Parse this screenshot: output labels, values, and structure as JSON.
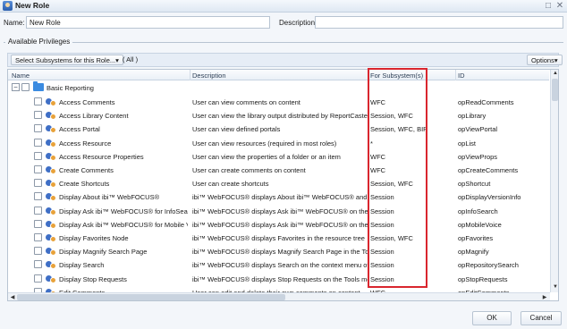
{
  "window": {
    "title": "New Role",
    "restore_glyph": "□",
    "close_glyph": "✕"
  },
  "form": {
    "name_label": "Name:",
    "name_value": "New Role",
    "description_label": "Description:",
    "description_value": ""
  },
  "privileges": {
    "legend": "Available Privileges",
    "subsystems_button": "Select Subsystems for this Role...▾",
    "subsystems_selected": "( All )",
    "options_button": "Options▾"
  },
  "grid": {
    "columns": [
      "Name",
      "Description",
      "For Subsystem(s)",
      "ID"
    ],
    "group": {
      "expander": "−",
      "label": "Basic Reporting"
    },
    "rows": [
      {
        "name": "Access Comments",
        "description": "User can view comments on content",
        "subsystems": "WFC",
        "id": "opReadComments"
      },
      {
        "name": "Access Library Content",
        "description": "User can view the library output distributed by ReportCaster",
        "subsystems": "Session, WFC",
        "id": "opLibrary"
      },
      {
        "name": "Access Portal",
        "description": "User can view defined portals",
        "subsystems": "Session, WFC, BIP",
        "id": "opViewPortal"
      },
      {
        "name": "Access Resource",
        "description": "User can view resources (required in most roles)",
        "subsystems": "*",
        "id": "opList"
      },
      {
        "name": "Access Resource Properties",
        "description": "User can view the properties of a folder or an item",
        "subsystems": "WFC",
        "id": "opViewProps"
      },
      {
        "name": "Create Comments",
        "description": "User can create comments on content",
        "subsystems": "WFC",
        "id": "opCreateComments"
      },
      {
        "name": "Create Shortcuts",
        "description": "User can create shortcuts",
        "subsystems": "Session, WFC",
        "id": "opShortcut"
      },
      {
        "name": "Display About ibi™ WebFOCUS®",
        "description": "ibi™ WebFOCUS® displays About ibi™ WebFOCUS® and Lic",
        "subsystems": "Session",
        "id": "opDisplayVersionInfo"
      },
      {
        "name": "Display Ask ibi™ WebFOCUS® for InfoSearch",
        "description": "ibi™ WebFOCUS® displays Ask ibi™ WebFOCUS® on the sid",
        "subsystems": "Session",
        "id": "opInfoSearch"
      },
      {
        "name": "Display Ask ibi™ WebFOCUS® for Mobile Voice",
        "description": "ibi™ WebFOCUS® displays Ask ibi™ WebFOCUS® on the sid",
        "subsystems": "Session",
        "id": "opMobileVoice"
      },
      {
        "name": "Display Favorites Node",
        "description": "ibi™ WebFOCUS® displays Favorites in the resource tree",
        "subsystems": "Session, WFC",
        "id": "opFavorites"
      },
      {
        "name": "Display Magnify Search Page",
        "description": "ibi™ WebFOCUS® displays Magnify Search Page in the Tools",
        "subsystems": "Session",
        "id": "opMagnify"
      },
      {
        "name": "Display Search",
        "description": "ibi™ WebFOCUS® displays Search on the context menu of t",
        "subsystems": "Session",
        "id": "opRepositorySearch"
      },
      {
        "name": "Display Stop Requests",
        "description": "ibi™ WebFOCUS® displays Stop Requests on the Tools menu",
        "subsystems": "Session",
        "id": "opStopRequests"
      },
      {
        "name": "Edit Comments",
        "description": "User can edit and delete their own comments on content",
        "subsystems": "WFC",
        "id": "opEditComments"
      }
    ]
  },
  "scroll": {
    "up": "▲",
    "down": "▼",
    "left": "◀",
    "right": "▶"
  },
  "buttons": {
    "ok": "OK",
    "cancel": "Cancel"
  },
  "colors": {
    "highlight_border": "#d9262e",
    "folder": "#3b8be0"
  }
}
